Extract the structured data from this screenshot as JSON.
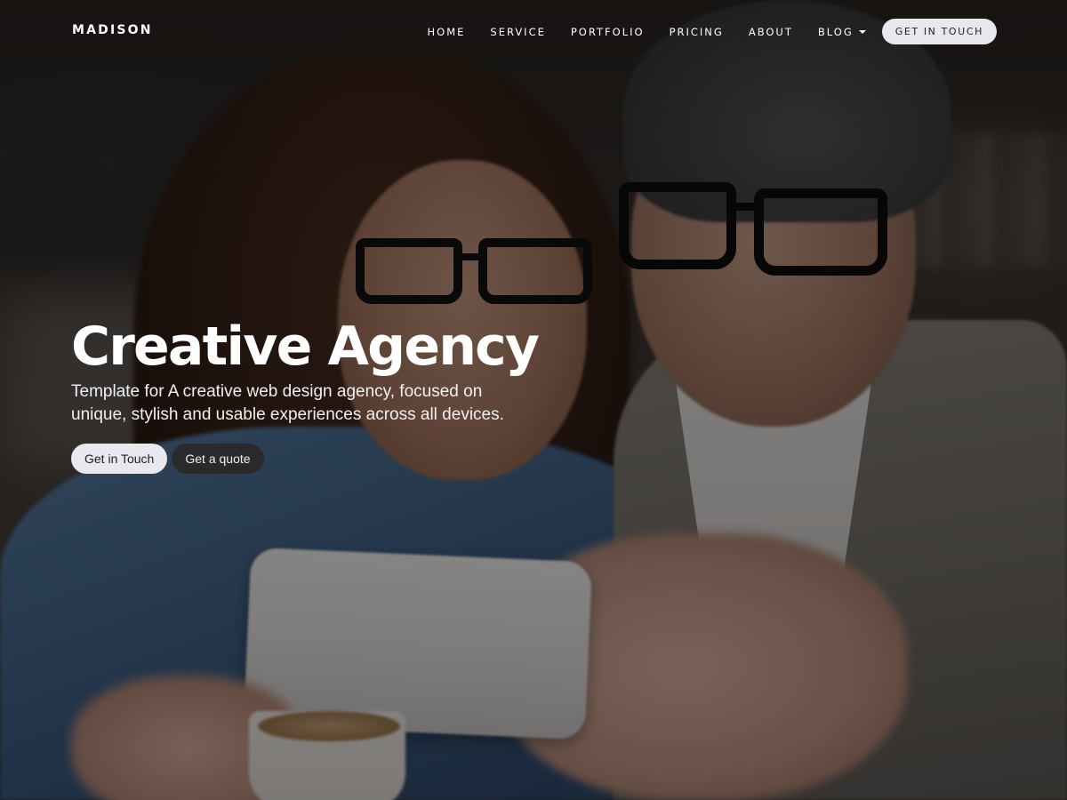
{
  "nav": {
    "brand": "MADISON",
    "links": [
      {
        "label": "HOME"
      },
      {
        "label": "SERVICE"
      },
      {
        "label": "PORTFOLIO"
      },
      {
        "label": "PRICING"
      },
      {
        "label": "ABOUT"
      },
      {
        "label": "BLOG"
      }
    ],
    "cta_label": "GET IN TOUCH"
  },
  "hero": {
    "title": "Creative Agency",
    "subtitle": "Template for A creative web design agency, focused on unique, stylish and usable experiences across all devices.",
    "primary_button": "Get in Touch",
    "secondary_button": "Get a quote"
  },
  "colors": {
    "button_light": "#e9e8ee",
    "button_dark": "#2a2a2a",
    "text": "#ffffff"
  },
  "icons": {
    "blog_dropdown": "caret-down-icon"
  }
}
